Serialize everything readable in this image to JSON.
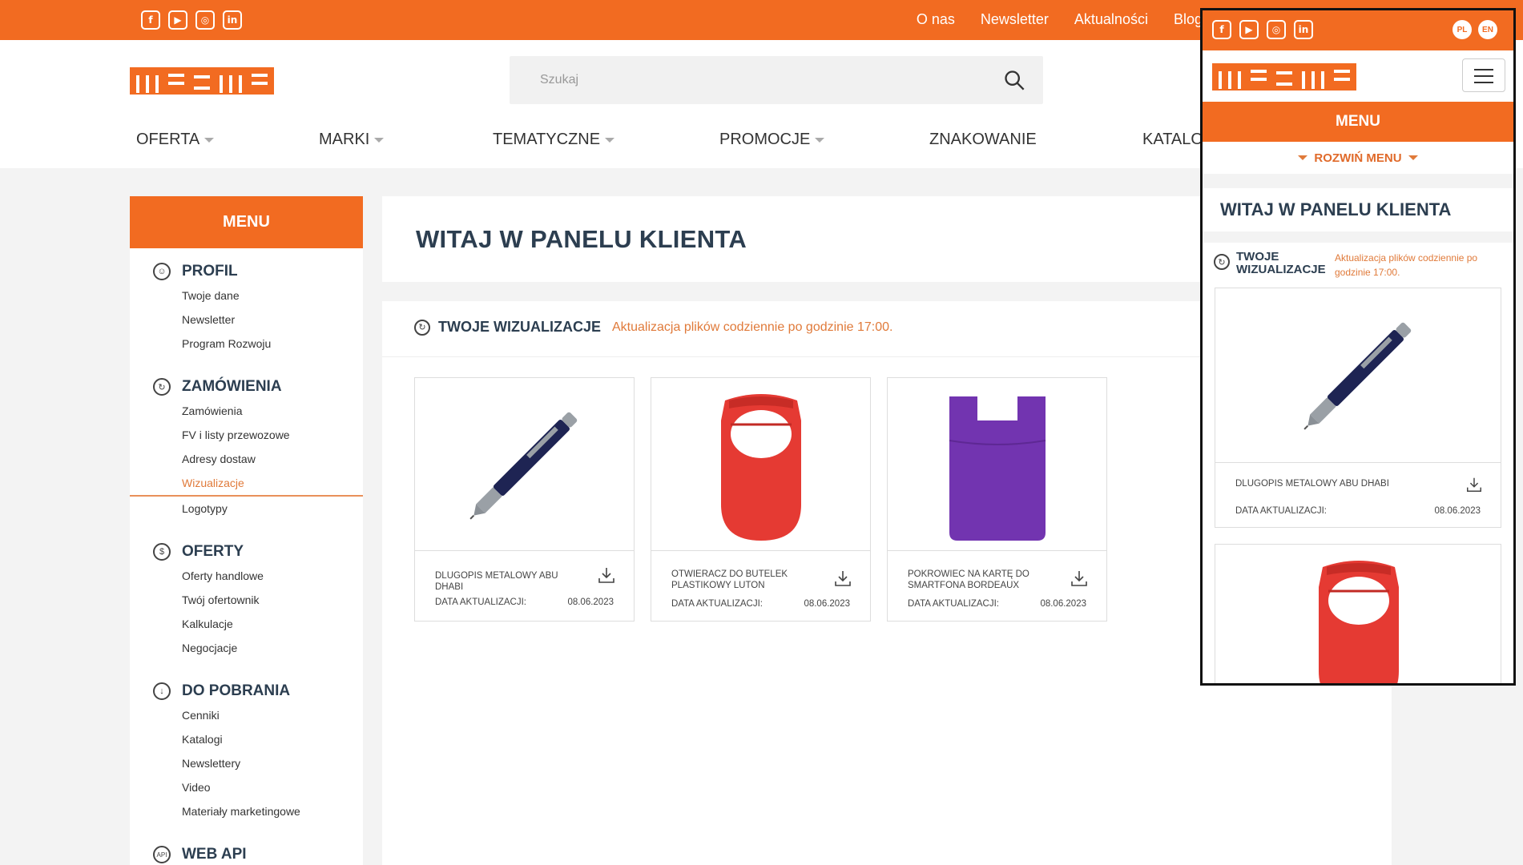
{
  "colors": {
    "brand": "#f26b21",
    "accent_text": "#e07a3a",
    "heading": "#2c3e50"
  },
  "social_icons": [
    "facebook-icon",
    "youtube-icon",
    "instagram-icon",
    "linkedin-icon"
  ],
  "topnav": {
    "items": [
      "O nas",
      "Newsletter",
      "Aktualności",
      "Blog"
    ]
  },
  "search": {
    "placeholder": "Szukaj"
  },
  "mainnav": {
    "items": [
      "OFERTA",
      "MARKI",
      "TEMATYCZNE",
      "PROMOCJE",
      "ZNAKOWANIE",
      "KATALO"
    ]
  },
  "sidebar": {
    "title": "MENU",
    "sections": [
      {
        "title": "PROFIL",
        "icon": "user-icon",
        "links": [
          "Twoje dane",
          "Newsletter",
          "Program Rozwoju"
        ]
      },
      {
        "title": "ZAMÓWIENIA",
        "icon": "refresh-icon",
        "links": [
          "Zamówienia",
          "FV i listy przewozowe",
          "Adresy dostaw",
          "Wizualizacje",
          "Logotypy"
        ]
      },
      {
        "title": "OFERTY",
        "icon": "dollar-icon",
        "links": [
          "Oferty handlowe",
          "Twój ofertownik",
          "Kalkulacje",
          "Negocjacje"
        ]
      },
      {
        "title": "DO POBRANIA",
        "icon": "download-icon",
        "links": [
          "Cenniki",
          "Katalogi",
          "Newslettery",
          "Video",
          "Materiały marketingowe"
        ]
      },
      {
        "title": "WEB API",
        "icon": "api-icon",
        "links": []
      }
    ],
    "active_link": "Wizualizacje"
  },
  "main": {
    "title": "WITAJ W PANELU KLIENTA",
    "viz_title": "TWOJE WIZUALIZACJE",
    "viz_note": "Aktualizacja plików codziennie po godzinie 17:00.",
    "date_label": "DATA AKTUALIZACJI:",
    "cards": [
      {
        "name": "DLUGOPIS METALOWY ABU DHABI",
        "date": "08.06.2023",
        "image": "pen"
      },
      {
        "name": "OTWIERACZ DO BUTELEK PLASTIKOWY LUTON",
        "date": "08.06.2023",
        "image": "bottle-opener"
      },
      {
        "name": "POKROWIEC NA KARTĘ DO SMARTFONA BORDEAUX",
        "date": "08.06.2023",
        "image": "card-holder"
      }
    ]
  },
  "mobile": {
    "langs": [
      "PL",
      "EN"
    ],
    "menu_label": "MENU",
    "expand_label": "ROZWIŃ MENU",
    "title": "WITAJ W PANELU KLIENTA",
    "viz_title": "TWOJE WIZUALIZACJE",
    "viz_note": "Aktualizacja plików codziennie po godzinie 17:00.",
    "card_name": "DLUGOPIS METALOWY ABU DHABI",
    "date_label": "DATA AKTUALIZACJI:",
    "card_date": "08.06.2023"
  }
}
